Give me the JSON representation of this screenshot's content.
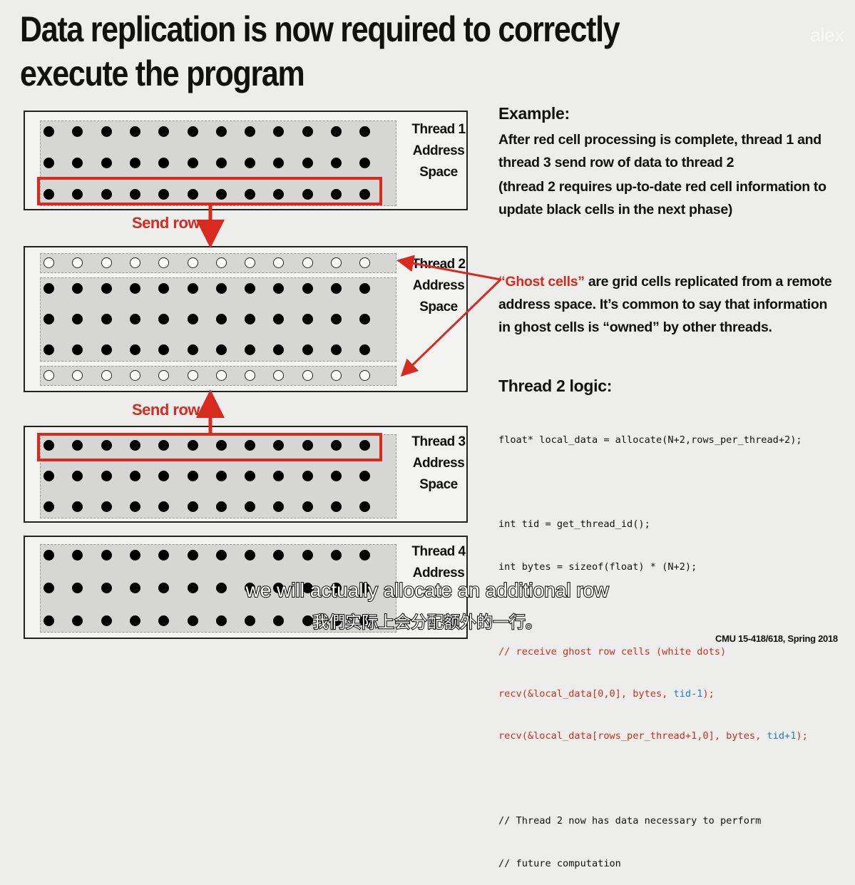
{
  "title_line1": "Data replication is now required to correctly",
  "title_line2": "execute the program",
  "watermark": "alex",
  "threads": [
    {
      "label_lines": [
        "Thread 1",
        "Address",
        "Space"
      ]
    },
    {
      "label_lines": [
        "Thread 2",
        "Address",
        "Space"
      ]
    },
    {
      "label_lines": [
        "Thread 3",
        "Address",
        "Space"
      ]
    },
    {
      "label_lines": [
        "Thread 4",
        "Address"
      ]
    }
  ],
  "send_row_label": "Send row",
  "example": {
    "heading": "Example:",
    "lines": [
      "After red cell processing is complete, thread 1 and",
      "thread 3 send row of data to thread 2",
      "(thread 2 requires up-to-date red cell information to",
      "update black cells in the next phase)"
    ]
  },
  "ghost": {
    "highlight": "“Ghost cells”",
    "line1_rest": " are grid cells replicated from a remote",
    "line2": "address space.  It’s common to say that information",
    "line3": "in ghost cells is “owned” by other threads."
  },
  "logic": {
    "heading": "Thread 2 logic:",
    "code_lines": [
      "float* local_data = allocate(N+2,rows_per_thread+2);",
      "",
      "int tid = get_thread_id();",
      "int bytes = sizeof(float) * (N+2);",
      "",
      "// receive ghost row cells (white dots)",
      "recv(&local_data[0,0], bytes, ",
      "tid-1",
      ");",
      "recv(&local_data[rows_per_thread+1,0], bytes, ",
      "tid+1",
      ");",
      "",
      "// Thread 2 now has data necessary to perform",
      "// future computation"
    ]
  },
  "subtitle_en": "we will actually allocate an additional row",
  "subtitle_zh": "我們实际上会分配额外的一行。",
  "footer": "CMU 15-418/618, Spring 2018"
}
